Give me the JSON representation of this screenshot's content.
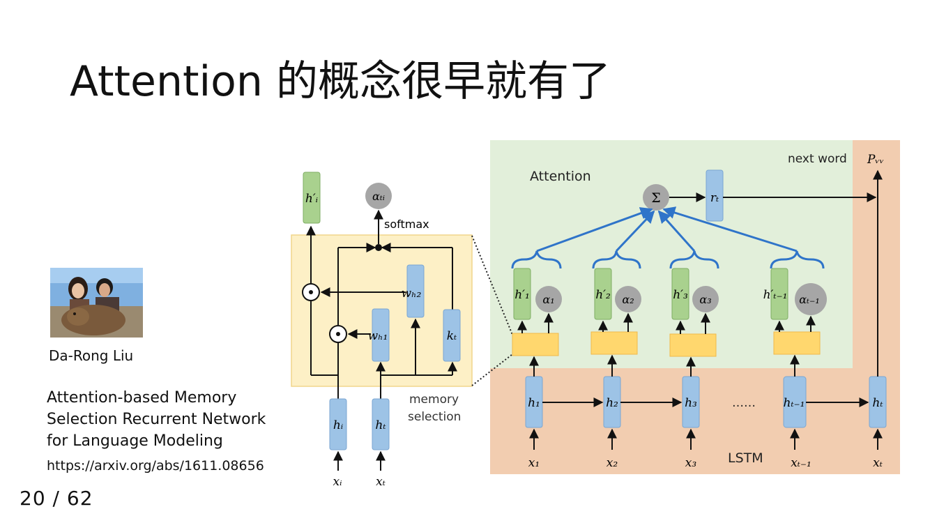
{
  "slide": {
    "title": "Attention 的概念很早就有了",
    "author": "Da-Rong Liu",
    "paper_title_lines": [
      "Attention-based Memory",
      "Selection Recurrent Network",
      "for Language Modeling"
    ],
    "paper_url": "https://arxiv.org/abs/1611.08656",
    "page_current": "20",
    "page_separator": "/",
    "page_total": "62"
  },
  "diagram": {
    "left": {
      "h_i_prime": "h′ᵢ",
      "alpha_ti": "αₜᵢ",
      "softmax": "softmax",
      "w_h2": "wₕ₂",
      "w_h1": "wₕ₁",
      "k_t": "kₜ",
      "h_i": "hᵢ",
      "h_t": "hₜ",
      "x_i": "xᵢ",
      "x_t": "xₜ",
      "memory_selection_lines": [
        "memory",
        "selection"
      ]
    },
    "right": {
      "attention_label": "Attention",
      "next_word": "next word",
      "p_w": "Pᵥᵥ",
      "sigma": "Σ",
      "r_t": "rₜ",
      "columns": [
        {
          "h_prime": "h′₁",
          "alpha": "α₁",
          "h": "h₁",
          "x": "x₁"
        },
        {
          "h_prime": "h′₂",
          "alpha": "α₂",
          "h": "h₂",
          "x": "x₂"
        },
        {
          "h_prime": "h′₃",
          "alpha": "α₃",
          "h": "h₃",
          "x": "x₃"
        },
        {
          "h_prime": "h′ₜ₋₁",
          "alpha": "αₜ₋₁",
          "h": "hₜ₋₁",
          "x": "xₜ₋₁"
        }
      ],
      "ellipsis": "……",
      "h_t": "hₜ",
      "x_t": "xₜ",
      "lstm_label": "LSTM"
    }
  }
}
